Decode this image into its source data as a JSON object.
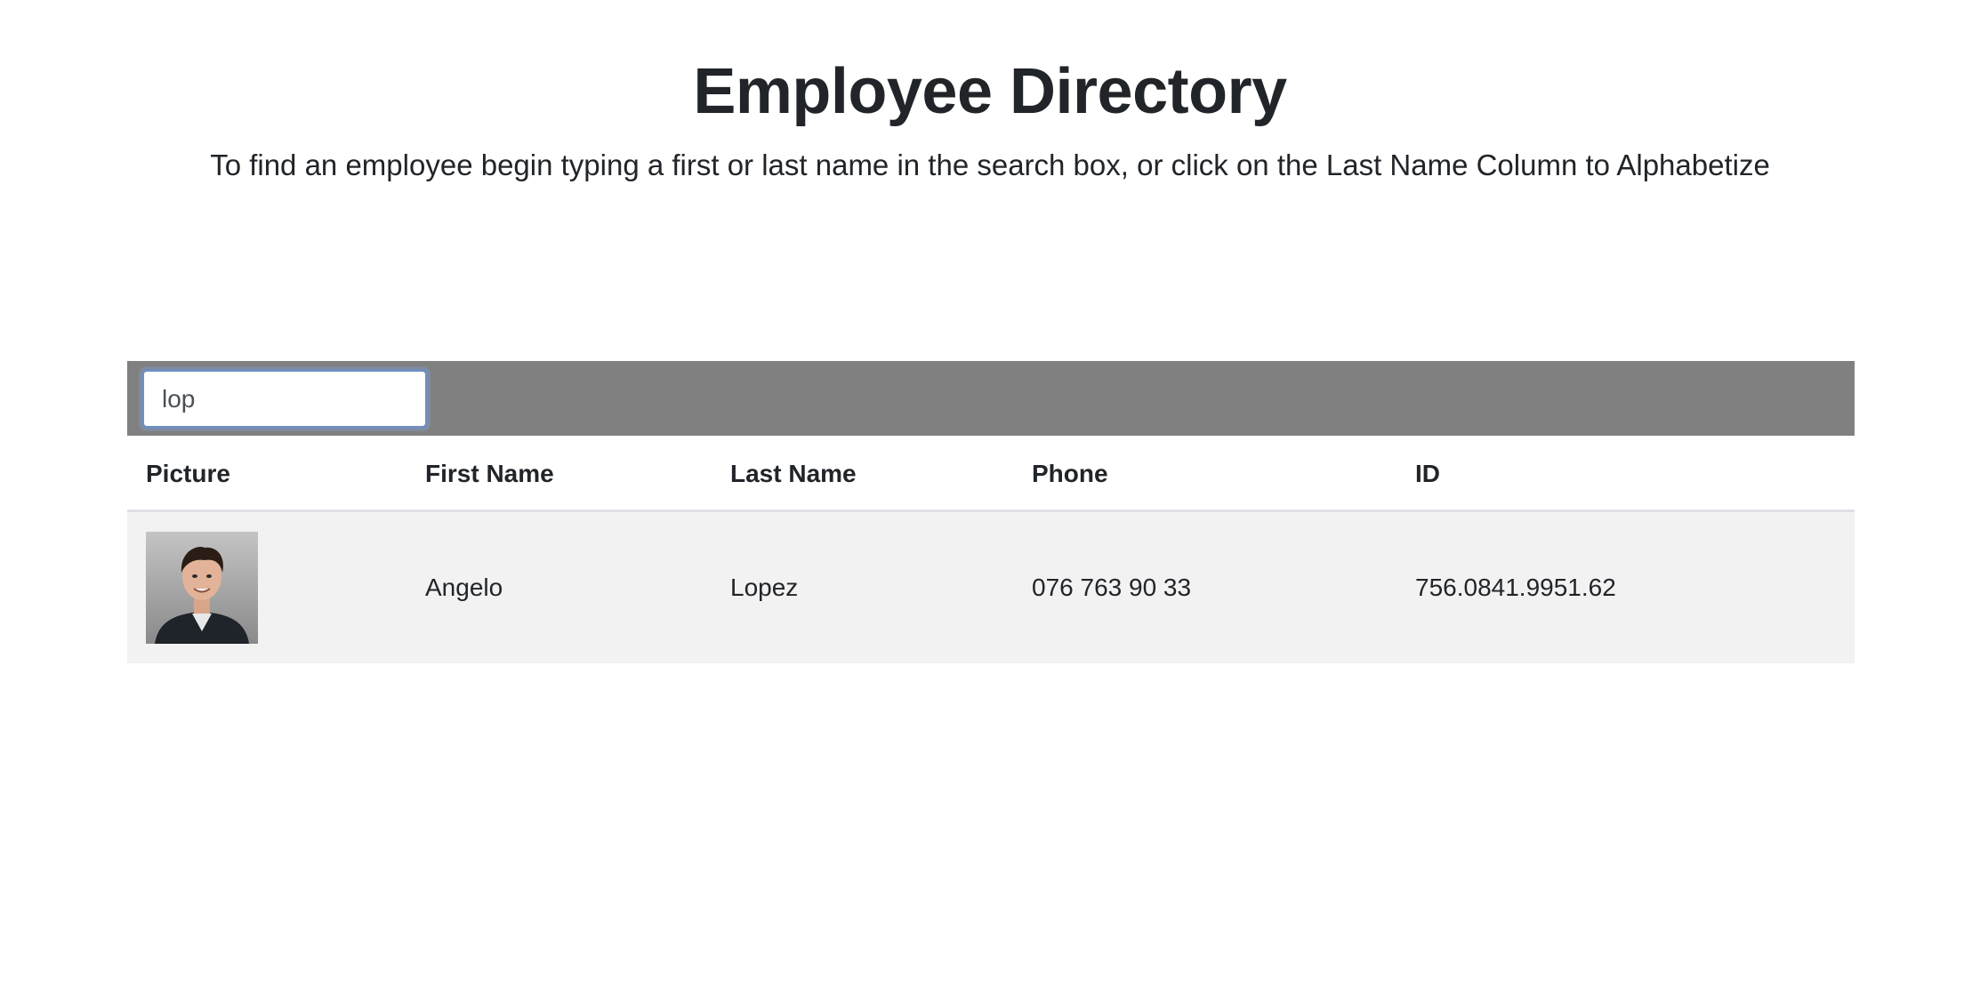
{
  "header": {
    "title": "Employee Directory",
    "subtitle": "To find an employee begin typing a first or last name in the search box, or click on the Last Name Column to Alphabetize"
  },
  "search": {
    "value": "lop",
    "placeholder": ""
  },
  "table": {
    "columns": [
      "Picture",
      "First Name",
      "Last Name",
      "Phone",
      "ID"
    ],
    "rows": [
      {
        "picture": "employee-photo",
        "first_name": "Angelo",
        "last_name": "Lopez",
        "phone": "076 763 90 33",
        "id": "756.0841.9951.62"
      }
    ]
  },
  "colors": {
    "search_bar_bg": "#808080",
    "row_bg": "#f2f2f2",
    "text": "#212529"
  }
}
